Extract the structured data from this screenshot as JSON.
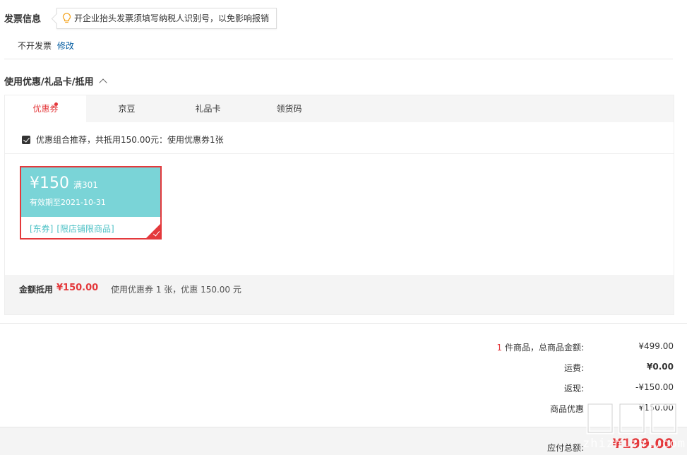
{
  "invoice": {
    "title": "发票信息",
    "tip": "开企业抬头发票须填写纳税人识别号，以免影响报销",
    "status": "不开发票",
    "modify": "修改"
  },
  "discount": {
    "title": "使用优惠/礼品卡/抵用",
    "tabs": [
      "优惠券",
      "京豆",
      "礼品卡",
      "领货码"
    ],
    "combo_text": "优惠组合推荐，共抵用150.00元：使用优惠券1张",
    "coupon": {
      "price": "¥150",
      "condition": "满301",
      "expiry": "有效期至2021-10-31",
      "tags": [
        "[东券]",
        "[限店铺限商品]"
      ]
    },
    "summary": {
      "label": "金额抵用",
      "amount": "¥150.00",
      "desc": "使用优惠券 1 张，优惠 150.00 元"
    }
  },
  "totals": {
    "items_count": "1",
    "items_label": "件商品，总商品金额:",
    "items_value": "¥499.00",
    "shipping_label": "运费:",
    "shipping_value": "¥0.00",
    "cashback_label": "返现:",
    "cashback_value": "-¥150.00",
    "promo_label": "商品优惠",
    "promo_value": "¥150.00",
    "pay_label": "应付总额:",
    "pay_value": "¥199.00"
  },
  "watermark": {
    "logo": "值值值",
    "text": "zhizhizhi.com"
  },
  "colors": {
    "accent_red": "#e4393c",
    "coupon_teal": "#7ad4d7",
    "link_blue": "#005aa0"
  }
}
